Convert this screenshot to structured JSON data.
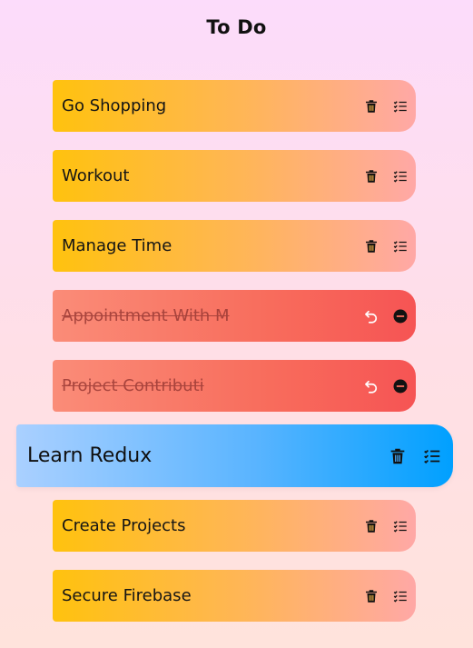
{
  "header": {
    "title": "To Do"
  },
  "todos": [
    {
      "label": "Go Shopping",
      "status": "pending"
    },
    {
      "label": "Workout",
      "status": "pending"
    },
    {
      "label": "Manage Time",
      "status": "pending"
    },
    {
      "label": "Appointment With M",
      "status": "completed"
    },
    {
      "label": "Project Contributi",
      "status": "completed"
    },
    {
      "label": "Learn Redux",
      "status": "dragging"
    },
    {
      "label": "Create Projects",
      "status": "pending"
    },
    {
      "label": "Secure Firebase",
      "status": "pending"
    }
  ],
  "icons": {
    "delete": "trash-icon",
    "complete": "checklist-icon",
    "undo": "undo-icon",
    "remove": "remove-circle-icon"
  },
  "colors": {
    "pending_start": "#ffc20e",
    "pending_end": "#ffa8a6",
    "completed_start": "#fa8c78",
    "completed_end": "#f65454",
    "active_start": "#aad0ff",
    "active_end": "#00a0ff"
  }
}
